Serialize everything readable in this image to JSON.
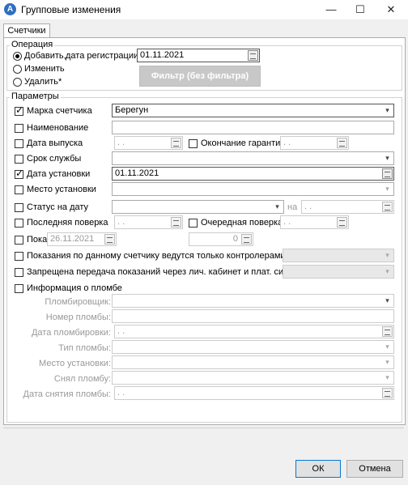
{
  "window": {
    "title": "Групповые изменения",
    "minimize": "—",
    "maximize": "☐",
    "close": "✕"
  },
  "tabs": [
    {
      "label": "Счетчики"
    }
  ],
  "operation": {
    "legend": "Операция",
    "options": [
      {
        "label": "Добавить,",
        "selected": true
      },
      {
        "label": "Изменить",
        "selected": false
      },
      {
        "label": "Удалить*",
        "selected": false
      }
    ],
    "reg_date_label": "дата регистрации:",
    "reg_date_value": "01.11.2021",
    "filter_button": "Фильтр (без фильтра)"
  },
  "params": {
    "legend": "Параметры",
    "marka": {
      "label": "Марка счетчика",
      "checked": true,
      "value": "Берегун"
    },
    "name": {
      "label": "Наименование",
      "checked": false,
      "value": ""
    },
    "release_date": {
      "label": "Дата выпуска",
      "checked": false,
      "value": " .  ."
    },
    "warranty_end": {
      "label": "Окончание гарантии",
      "checked": false,
      "value": " .  ."
    },
    "service_life": {
      "label": "Срок службы",
      "checked": false,
      "value": ""
    },
    "install_date": {
      "label": "Дата установки",
      "checked": true,
      "value": "01.11.2021"
    },
    "install_place": {
      "label": "Место установки",
      "checked": false,
      "value": ""
    },
    "status_date": {
      "label": "Статус на дату",
      "checked": false,
      "value": "",
      "na_label": "на",
      "na_value": " .  ."
    },
    "last_check": {
      "label": "Последняя поверка",
      "checked": false,
      "value": " .  ."
    },
    "next_check": {
      "label": "Очередная поверка",
      "checked": false,
      "value": " .  ."
    },
    "poka": {
      "label": "Пока",
      "checked": false,
      "date_value": "26.11.2021",
      "num_value": "0"
    },
    "controllers_only": {
      "label": "Показания по данному счетчику ведутся только контролерами",
      "checked": false
    },
    "no_cabinet": {
      "label": "Запрещена передача показаний через лич. кабинет и плат. систему",
      "checked": false
    },
    "seal_info": {
      "label": "Информация о пломбе",
      "checked": false
    },
    "seal_fields": [
      {
        "label": "Пломбировщик:",
        "kind": "combo",
        "value": ""
      },
      {
        "label": "Номер пломбы:",
        "kind": "text",
        "value": ""
      },
      {
        "label": "Дата пломбировки:",
        "kind": "date",
        "value": " .  ."
      },
      {
        "label": "Тип пломбы:",
        "kind": "combo",
        "value": ""
      },
      {
        "label": "Место установки:",
        "kind": "combo",
        "value": ""
      },
      {
        "label": "Снял пломбу:",
        "kind": "combo",
        "value": ""
      },
      {
        "label": "Дата снятия пломбы:",
        "kind": "date",
        "value": " .  ."
      }
    ]
  },
  "footer": {
    "ok": "ОК",
    "cancel": "Отмена"
  },
  "icons": {
    "app": "A",
    "combo": "▾",
    "date": "calendar-icon"
  }
}
